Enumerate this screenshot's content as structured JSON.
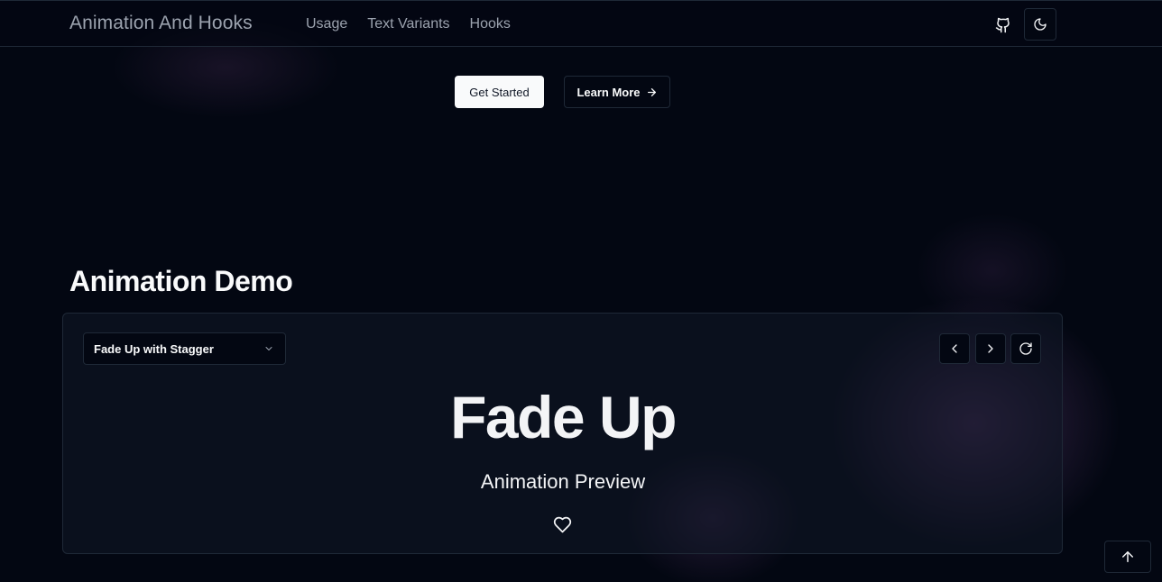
{
  "header": {
    "brand": "Animation And Hooks",
    "nav": [
      {
        "label": "Usage"
      },
      {
        "label": "Text Variants"
      },
      {
        "label": "Hooks"
      }
    ],
    "icons": {
      "github": "github-icon",
      "theme": "moon-icon"
    }
  },
  "hero": {
    "get_started": "Get Started",
    "learn_more": "Learn More"
  },
  "demo": {
    "title": "Animation Demo",
    "select": {
      "value": "Fade Up with Stagger"
    },
    "controls": [
      "chevron-left-icon",
      "chevron-right-icon",
      "refresh-icon"
    ],
    "preview_title": "Fade Up",
    "preview_subtitle": "Animation Preview"
  },
  "colors": {
    "background": "#030712",
    "border": "#1f2937",
    "text": "#f3f4f6",
    "muted": "#9ca3af",
    "glow": "#965aaa"
  }
}
